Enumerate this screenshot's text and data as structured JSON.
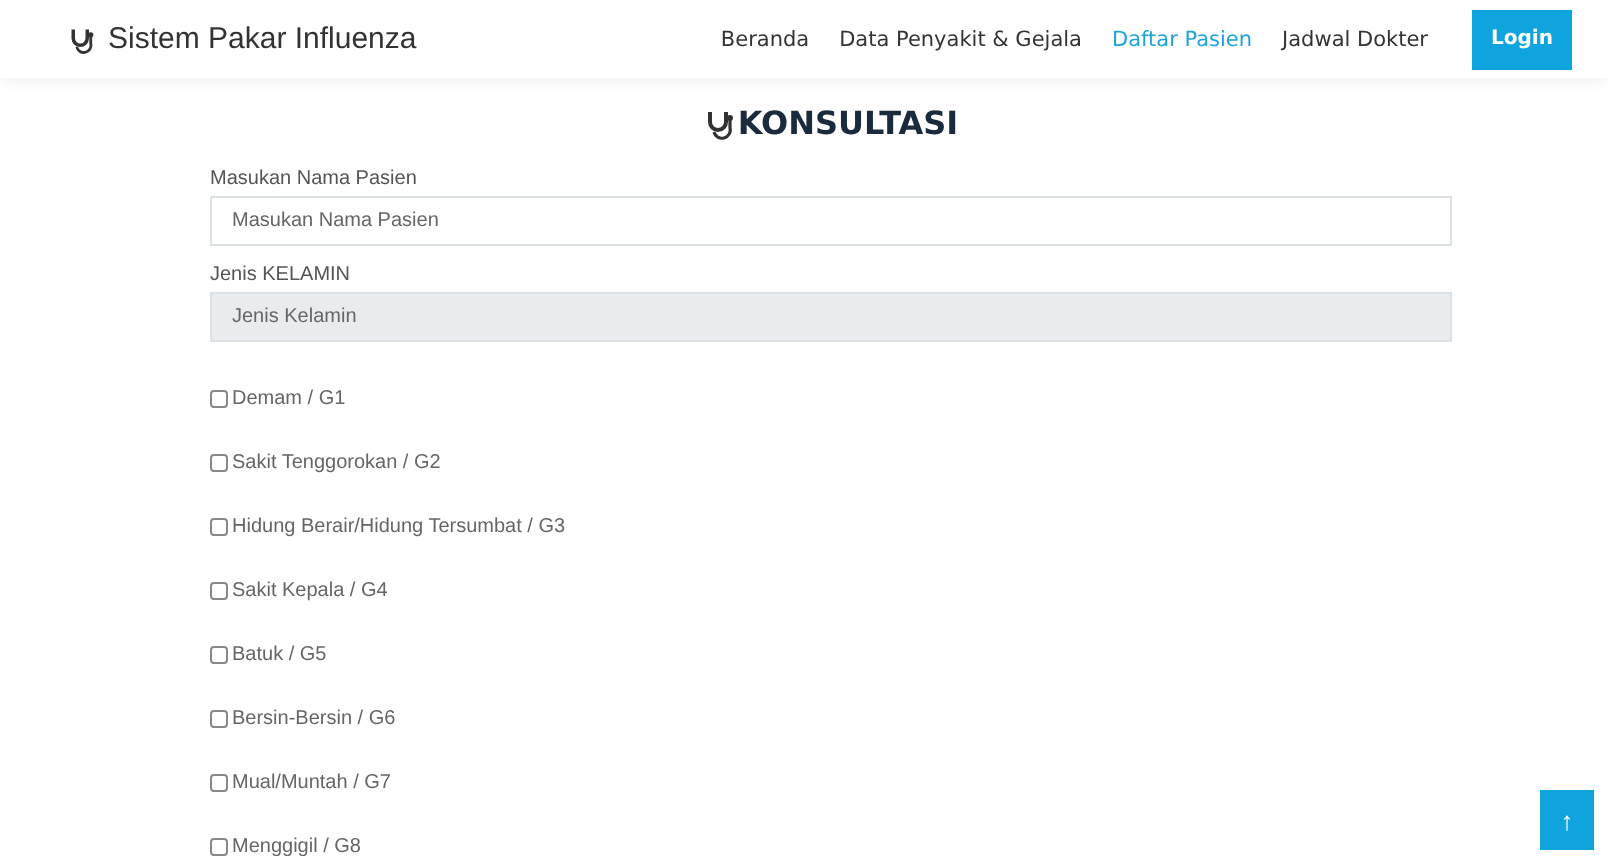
{
  "brand": "Sistem Pakar Influenza",
  "nav": [
    {
      "label": "Beranda",
      "selected": false
    },
    {
      "label": "Data Penyakit & Gejala",
      "selected": false
    },
    {
      "label": "Daftar Pasien",
      "selected": true
    },
    {
      "label": "Jadwal Dokter",
      "selected": false
    }
  ],
  "login_button": "Login",
  "heading": "KONSULTASI",
  "name_field": {
    "label": "Masukan Nama Pasien",
    "placeholder": "Masukan Nama Pasien"
  },
  "gender_field": {
    "label": "Jenis KELAMIN",
    "placeholder": "Jenis Kelamin",
    "disabled": true
  },
  "symptoms": [
    {
      "label": "Demam / G1",
      "checked": false
    },
    {
      "label": "Sakit Tenggorokan / G2",
      "checked": false
    },
    {
      "label": "Hidung Berair/Hidung Tersumbat / G3",
      "checked": false
    },
    {
      "label": "Sakit Kepala / G4",
      "checked": false
    },
    {
      "label": "Batuk / G5",
      "checked": false
    },
    {
      "label": "Bersin-Bersin / G6",
      "checked": false
    },
    {
      "label": "Mual/Muntah / G7",
      "checked": false
    },
    {
      "label": "Menggigil / G8",
      "checked": false
    }
  ],
  "back_to_top": "↑"
}
